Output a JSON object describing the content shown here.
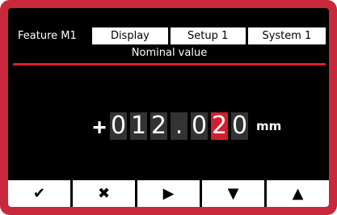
{
  "tabs": [
    {
      "label": "Feature M1",
      "active": true
    },
    {
      "label": "Display",
      "active": false
    },
    {
      "label": "Setup 1",
      "active": false
    },
    {
      "label": "System 1",
      "active": false
    }
  ],
  "subtitle": "Nominal value",
  "value": {
    "sign": "+",
    "digits": [
      "0",
      "1",
      "2",
      ".",
      "0",
      "2",
      "0"
    ],
    "selected_index": 5,
    "unit": "mm"
  },
  "softkeys": [
    {
      "icon": "check-icon",
      "glyph": "✔"
    },
    {
      "icon": "cross-icon",
      "glyph": "✖"
    },
    {
      "icon": "right-arrow-icon",
      "glyph": "▶"
    },
    {
      "icon": "down-arrow-icon",
      "glyph": "▼"
    },
    {
      "icon": "up-arrow-icon",
      "glyph": "▲"
    }
  ],
  "colors": {
    "frame": "#c8283a",
    "accent": "#e21b2c",
    "selected_digit": "#d21f2f"
  }
}
